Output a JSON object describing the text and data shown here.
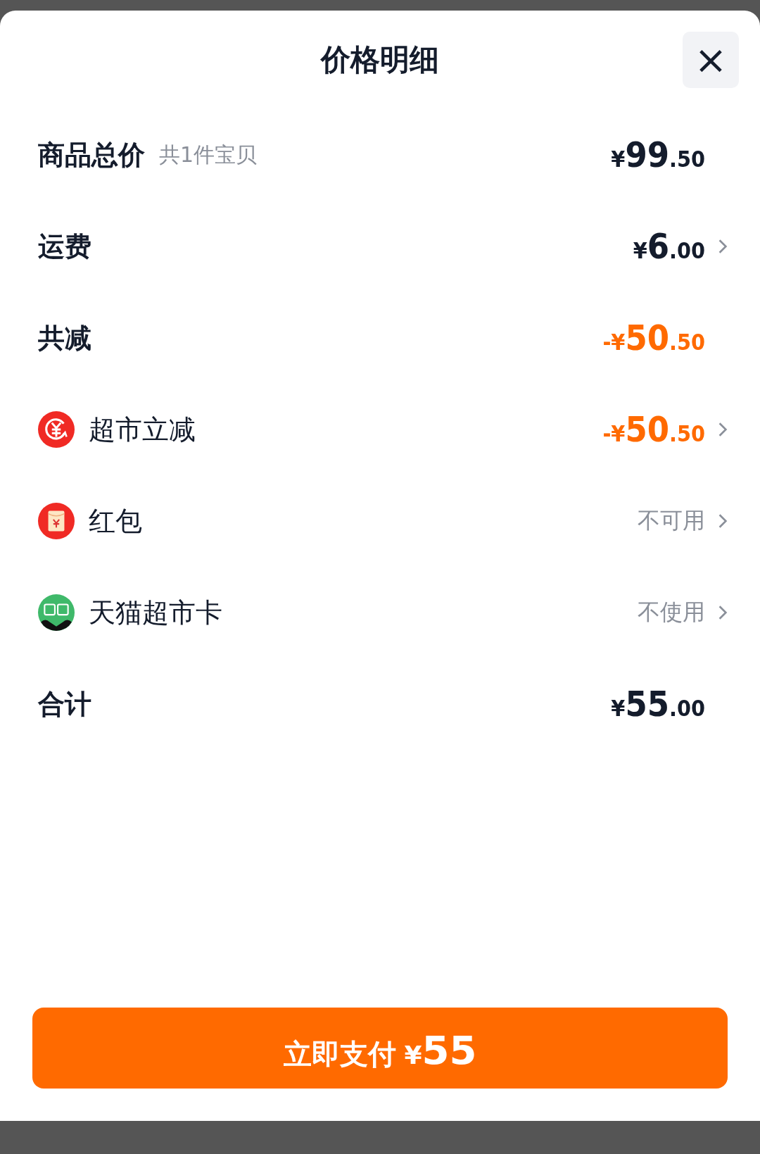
{
  "sheet": {
    "title": "价格明细",
    "close_button": "×"
  },
  "rows": [
    {
      "kind": "plain",
      "label": "商品总价",
      "note": "共1件宝贝",
      "discount": false,
      "price": {
        "lead": "¥",
        "whole": "99",
        "fraction": ".50"
      },
      "chevron": false
    },
    {
      "kind": "plain",
      "label": "运费",
      "discount": false,
      "price": {
        "lead": "¥",
        "whole": "6",
        "fraction": ".00"
      },
      "chevron": true
    },
    {
      "kind": "plain",
      "label": "共减",
      "discount": true,
      "price": {
        "lead": "-¥",
        "whole": "50",
        "fraction": ".50"
      },
      "chevron": false
    },
    {
      "kind": "coupon",
      "label": "超市立减",
      "discount": true,
      "price": {
        "lead": "-¥",
        "whole": "50",
        "fraction": ".50"
      },
      "chevron": true
    },
    {
      "kind": "packet",
      "label": "红包",
      "hint": "不可用",
      "chevron": true
    },
    {
      "kind": "card",
      "label": "天猫超市卡",
      "hint": "不使用",
      "chevron": true
    },
    {
      "kind": "plain",
      "label": "合计",
      "discount": false,
      "price": {
        "lead": "¥",
        "whole": "55",
        "fraction": ".00"
      },
      "chevron": false
    }
  ],
  "pay_button": {
    "label": "立即支付",
    "amount_lead": "¥",
    "amount": "55"
  }
}
